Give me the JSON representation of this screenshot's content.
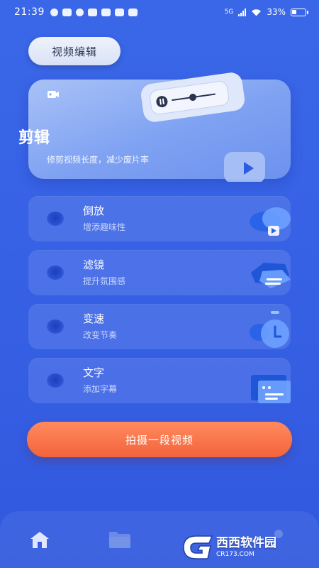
{
  "status_bar": {
    "time": "21:39",
    "network": "5G",
    "battery": "33%",
    "battery_level": 0.33
  },
  "header": {
    "title": "视频编辑"
  },
  "hero": {
    "title": "剪辑",
    "subtitle": "修剪视频长度，减少废片率"
  },
  "features": [
    {
      "title": "倒放",
      "subtitle": "增添趣味性",
      "icon": "cloud-play-icon"
    },
    {
      "title": "滤镜",
      "subtitle": "提升氛围感",
      "icon": "filter-layers-icon"
    },
    {
      "title": "变速",
      "subtitle": "改变节奏",
      "icon": "timer-icon"
    },
    {
      "title": "文字",
      "subtitle": "添加字幕",
      "icon": "subtitle-icon"
    }
  ],
  "primary_action": {
    "label": "拍摄一段视频"
  },
  "bottom_nav": {
    "items": [
      {
        "icon": "home-icon"
      },
      {
        "icon": "folder-icon"
      },
      {
        "icon": "profile-icon"
      }
    ]
  },
  "watermark": {
    "brand": "G",
    "name": "西西软件园",
    "url": "CR173.COM"
  },
  "colors": {
    "background": "#3660e4",
    "accent_orange": "#f4633c",
    "card": "#7ea1f2"
  }
}
